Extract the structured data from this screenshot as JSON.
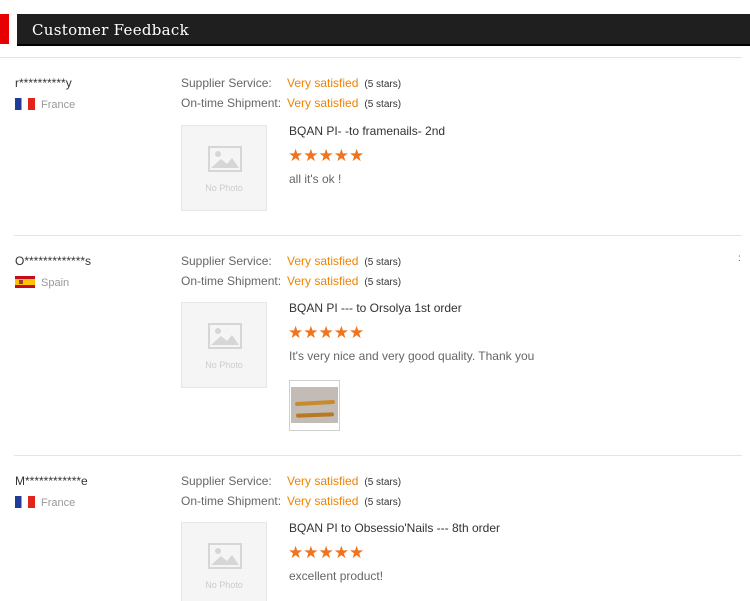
{
  "header": {
    "title": "Customer Feedback"
  },
  "labels": {
    "supplier_service": "Supplier Service:",
    "ontime_shipment": "On-time Shipment:",
    "no_photo": "No Photo"
  },
  "reviews": [
    {
      "user": "r**********y",
      "country": "France",
      "supplier_rating": "Very satisfied",
      "supplier_stars": "(5 stars)",
      "shipment_rating": "Very satisfied",
      "shipment_stars": "(5 stars)",
      "product": "BQAN PI- -to framenails- 2nd",
      "stars": "★★★★★",
      "comment": "all it's ok !"
    },
    {
      "user": "O*************s",
      "country": "Spain",
      "supplier_rating": "Very satisfied",
      "supplier_stars": "(5 stars)",
      "shipment_rating": "Very satisfied",
      "shipment_stars": "(5 stars)",
      "product": "BQAN PI --- to Orsolya 1st order",
      "stars": "★★★★★",
      "comment": "It's very nice and very good quality. Thank you"
    },
    {
      "user": "M************e",
      "country": "France",
      "supplier_rating": "Very satisfied",
      "supplier_stars": "(5 stars)",
      "shipment_rating": "Very satisfied",
      "shipment_stars": "(5 stars)",
      "product": "BQAN PI to Obsessio'Nails --- 8th order",
      "stars": "★★★★★",
      "comment": "excellent product!"
    }
  ],
  "edge_mark": ":",
  "colors": {
    "accent_red": "#e60000",
    "rating_orange": "#f08200",
    "star_orange": "#f0741e",
    "header_bg": "#1f1f1f"
  }
}
